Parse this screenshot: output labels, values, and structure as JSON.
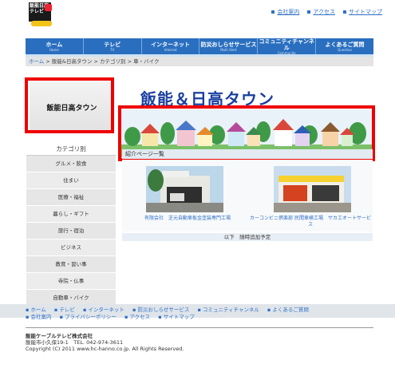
{
  "header": {
    "logo_text": "飯能日高テレビ",
    "links": [
      "会社案内",
      "アクセス",
      "サイトマップ"
    ]
  },
  "nav": [
    {
      "jp": "ホーム",
      "en": "Home"
    },
    {
      "jp": "テレビ",
      "en": "TV"
    },
    {
      "jp": "インターネット",
      "en": "Internet"
    },
    {
      "jp": "防災おしらせサービス",
      "en": "Multi Alert"
    },
    {
      "jp": "コミュニティチャンネル",
      "en": "Community"
    },
    {
      "jp": "よくあるご質問",
      "en": "Question"
    }
  ],
  "breadcrumb": {
    "home": "ホーム",
    "rest": " > 飯能&日高タウン > カテゴリ別 > 車・バイク"
  },
  "sidebar": {
    "banner_label": "飯能日高タウン",
    "category_heading": "カテゴリ別",
    "items": [
      "グルメ・飲食",
      "住まい",
      "医療・福祉",
      "暮らし・ギフト",
      "旅行・宿泊",
      "ビジネス",
      "教育・習い事",
      "寺院・仏事",
      "自動車・バイク"
    ]
  },
  "main": {
    "title": "飯能＆日高タウン",
    "section_heading": "紹介ページ一覧",
    "listings": [
      {
        "caption": "有限会社　芝元自動車板金塗装専門工場"
      },
      {
        "caption": "カーコンビニ倶楽部 民間車検工場　サカエオートサービス"
      }
    ],
    "more": "以下　随時追加予定"
  },
  "footer": {
    "links_row1": [
      "ホーム",
      "テレビ",
      "インターネット",
      "防災おしらせサービス",
      "コミュニティチャンネル",
      "よくあるご質問"
    ],
    "links_row2": [
      "会社案内",
      "プライバシーポリシー",
      "アクセス",
      "サイトマップ"
    ],
    "company": "飯能ケーブルテレビ株式会社",
    "address": "飯能市小久保19-1　TEL. 042-974-3611",
    "copyright": "Copyright (C) 2011 www.hc-hanno.co.jp. All Rights Reserved."
  },
  "colors": {
    "nav": "#2a6fbf",
    "highlight": "#e00000",
    "title": "#1a3fa0",
    "link": "#3170c6"
  }
}
